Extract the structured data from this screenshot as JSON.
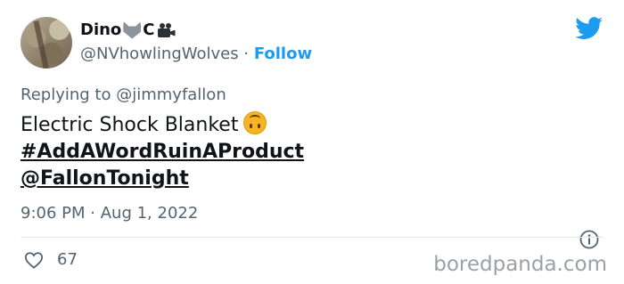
{
  "author": {
    "display_name": "Dino",
    "name_suffix": "C",
    "handle": "@NVhowlingWolves",
    "separator": "·",
    "follow_label": "Follow"
  },
  "icons": {
    "brand": "twitter-bird-icon",
    "name_emoji_1": "wolf-emoji-icon",
    "name_emoji_2": "movie-camera-emoji-icon",
    "content_emoji": "upside-down-face-emoji-icon",
    "info": "info-icon",
    "like": "heart-icon"
  },
  "colors": {
    "link": "#1d9bf0",
    "muted": "#536471",
    "text": "#0f1419"
  },
  "reply": {
    "prefix": "Replying to",
    "to": "@jimmyfallon"
  },
  "tweet": {
    "text": "Electric Shock Blanket",
    "hashtag": "#AddAWordRuinAProduct",
    "mention": "@FallonTonight"
  },
  "meta": {
    "time": "9:06 PM",
    "separator": "·",
    "date": "Aug 1, 2022"
  },
  "stats": {
    "likes": "67"
  },
  "watermark": "boredpanda.com"
}
